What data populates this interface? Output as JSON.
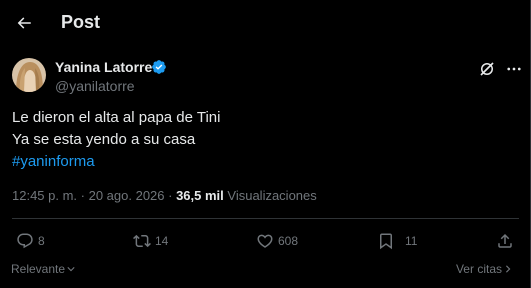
{
  "header": {
    "title": "Post"
  },
  "author": {
    "name": "Yanina Latorre",
    "handle": "@yanilatorre",
    "verified_color": "#1d9bf0"
  },
  "tweet": {
    "line1": "Le dieron el alta al papa de Tini",
    "line2": "Ya se esta yendo a su casa",
    "hashtag": "#yaninforma"
  },
  "meta": {
    "time": "12:45 p. m.",
    "sep1": " · ",
    "date": "20 ago. 2026",
    "sep2": " · ",
    "views_count": "36,5 mil",
    "views_label": " Visualizaciones"
  },
  "actions": {
    "replies": "8",
    "reposts": "14",
    "likes": "608",
    "bookmarks": "11"
  },
  "footer": {
    "sort_label": "Relevante",
    "quotes_label": "Ver citas"
  },
  "colors": {
    "background": "#000000",
    "text": "#e7e9ea",
    "muted": "#71767b",
    "accent": "#1d9bf0",
    "divider": "#2f3336"
  }
}
